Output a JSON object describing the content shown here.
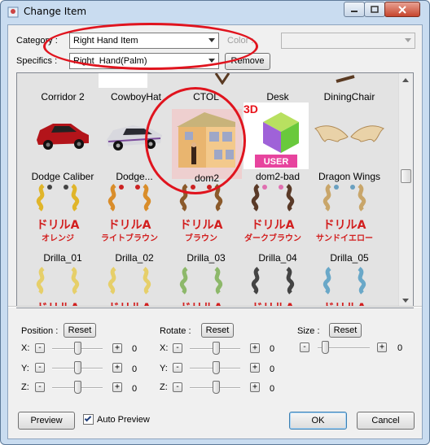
{
  "window": {
    "title": "Change Item"
  },
  "form": {
    "category_label": "Category :",
    "category_value": "Right Hand Item",
    "color_label": "Color :",
    "color_value": "",
    "specifics_label": "Specifics :",
    "specifics_value": "Right_Hand(Palm)",
    "remove_label": "Remove"
  },
  "gallery": {
    "row1_partial": [
      "Corridor 2",
      "CowboyHat",
      "CTOL",
      "Desk",
      "DiningChair"
    ],
    "row2": [
      "Dodge Caliber",
      "Dodge...",
      "dom2",
      "dom2-bad",
      "Dragon Wings"
    ],
    "row3": [
      "Drilla_01",
      "Drilla_02",
      "Drilla_03",
      "Drilla_04",
      "Drilla_05"
    ],
    "drilla_captions": [
      {
        "line1": "ドリルA",
        "line2": "オレンジ"
      },
      {
        "line1": "ドリルA",
        "line2": "ライトブラウン"
      },
      {
        "line1": "ドリルA",
        "line2": "ブラウン"
      },
      {
        "line1": "ドリルA",
        "line2": "ダークブラウン"
      },
      {
        "line1": "ドリルA",
        "line2": "サンドイエロー"
      }
    ],
    "bottom_caption": "ドリルA",
    "user_badge": {
      "top": "3D",
      "bottom": "USER"
    },
    "selected": "dom2"
  },
  "controls": {
    "position_label": "Position :",
    "rotate_label": "Rotate :",
    "size_label": "Size :",
    "reset_label": "Reset",
    "axis_x": "X:",
    "axis_y": "Y:",
    "axis_z": "Z:",
    "minus": "-",
    "plus": "+",
    "position_values": [
      "0",
      "0",
      "0"
    ],
    "rotate_values": [
      "0",
      "0",
      "0"
    ],
    "size_value": "0"
  },
  "footer": {
    "preview_label": "Preview",
    "auto_preview_label": "Auto Preview",
    "auto_preview_checked": true,
    "ok_label": "OK",
    "cancel_label": "Cancel"
  },
  "colors": {
    "annotation": "#e0141e",
    "drilla_text": "#d21e1e",
    "selected_bg": "#eecfcf"
  }
}
